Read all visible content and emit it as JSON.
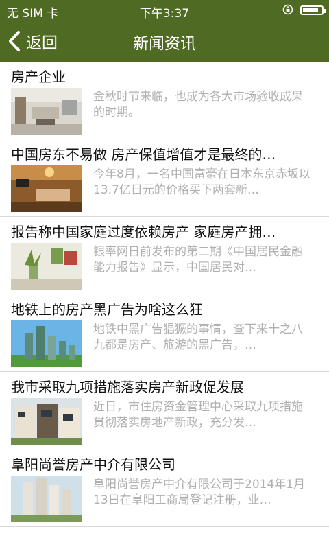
{
  "status_bar": {
    "carrier": "无 SIM 卡",
    "time": "下午3:37",
    "battery_level": 0.85
  },
  "navbar": {
    "back_label": "返回",
    "title": "新闻资讯"
  },
  "news": [
    {
      "title": "房产企业",
      "summary": "金秋时节来临，也成为各大市场验收成果的时期。",
      "thumb": "living-room-image"
    },
    {
      "title": "中国房东不易做 房产保值增值才是最终的…",
      "summary": "今年8月，一名中国富豪在日本东京赤坂以13.7亿日元的价格买下两套新…",
      "thumb": "warm-living-room-image"
    },
    {
      "title": "报告称中国家庭过度依赖房产 家庭房产拥…",
      "summary": "银率网日前发布的第二期《中国居民金融能力报告》显示，中国居民对…",
      "thumb": "home-decor-image"
    },
    {
      "title": "地铁上的房产黑广告为啥这么狂",
      "summary": "地铁中黑广告猖獗的事情，查下来十之八九都是房产、旅游的黑广告，…",
      "thumb": "skyscrapers-image"
    },
    {
      "title": "我市采取九项措施落实房产新政促发展",
      "summary": "近日，市住房资金管理中心采取九项措施贯彻落实房地产新政，充分发…",
      "thumb": "townhouse-image"
    },
    {
      "title": "阜阳尚誉房产中介有限公司",
      "summary": "阜阳尚誉房产中介有限公司于2014年1月13日在阜阳工商局登记注册，业…",
      "thumb": "apartment-towers-image"
    }
  ]
}
